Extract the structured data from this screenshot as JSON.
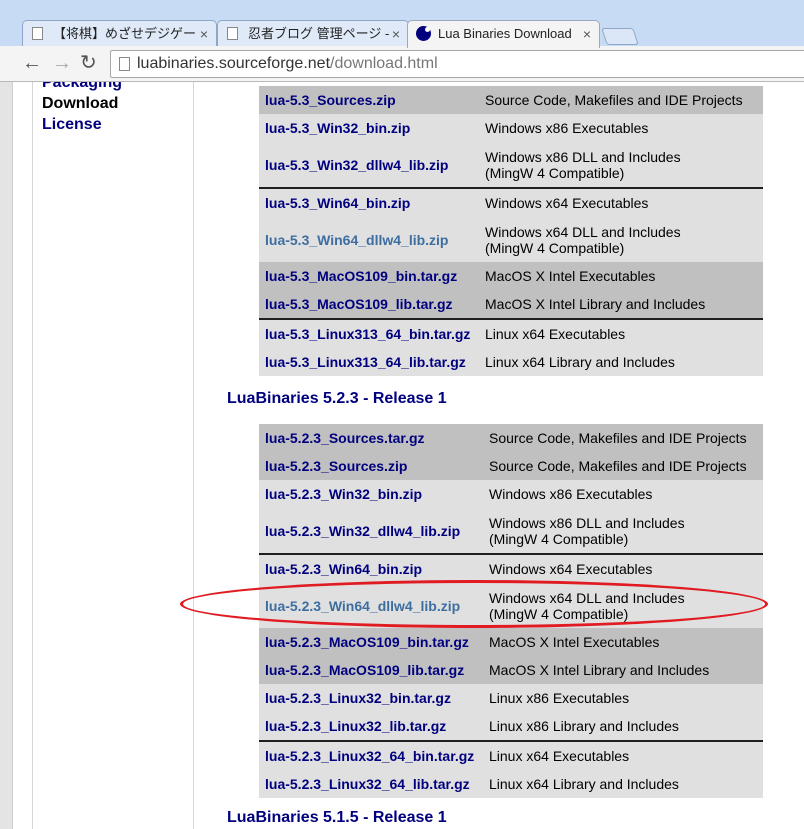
{
  "browser": {
    "tabs": [
      {
        "label": "【将棋】めざせデジゲー"
      },
      {
        "label": "忍者ブログ 管理ページ -"
      },
      {
        "label": "Lua Binaries Download"
      }
    ],
    "close_glyph": "×",
    "url_domain": "luabinaries.sourceforge.net",
    "url_path": "/download.html"
  },
  "sidebar": {
    "items": [
      {
        "label": "Packaging"
      },
      {
        "label": "Download"
      },
      {
        "label": "License"
      }
    ]
  },
  "section_53": {
    "files": [
      {
        "file": "lua-5.3_Sources.zip",
        "desc": "Source Code, Makefiles and IDE Projects"
      },
      {
        "file": "lua-5.3_Win32_bin.zip",
        "desc": "Windows x86 Executables"
      },
      {
        "file": "lua-5.3_Win32_dllw4_lib.zip",
        "desc": "Windows x86 DLL and Includes",
        "desc2": "(MingW 4 Compatible)"
      },
      {
        "file": "lua-5.3_Win64_bin.zip",
        "desc": "Windows x64 Executables"
      },
      {
        "file": "lua-5.3_Win64_dllw4_lib.zip",
        "desc": "Windows x64 DLL and Includes",
        "desc2": "(MingW 4 Compatible)"
      },
      {
        "file": "lua-5.3_MacOS109_bin.tar.gz",
        "desc": "MacOS X Intel Executables"
      },
      {
        "file": "lua-5.3_MacOS109_lib.tar.gz",
        "desc": "MacOS X Intel Library and Includes"
      },
      {
        "file": "lua-5.3_Linux313_64_bin.tar.gz",
        "desc": "Linux x64 Executables"
      },
      {
        "file": "lua-5.3_Linux313_64_lib.tar.gz",
        "desc": "Linux x64 Library and Includes"
      }
    ]
  },
  "section_523": {
    "title": "LuaBinaries 5.2.3 - Release 1",
    "files": [
      {
        "file": "lua-5.2.3_Sources.tar.gz",
        "desc": "Source Code, Makefiles and IDE Projects"
      },
      {
        "file": "lua-5.2.3_Sources.zip",
        "desc": "Source Code, Makefiles and IDE Projects"
      },
      {
        "file": "lua-5.2.3_Win32_bin.zip",
        "desc": "Windows x86 Executables"
      },
      {
        "file": "lua-5.2.3_Win32_dllw4_lib.zip",
        "desc": "Windows x86 DLL and Includes",
        "desc2": "(MingW 4 Compatible)"
      },
      {
        "file": "lua-5.2.3_Win64_bin.zip",
        "desc": "Windows x64 Executables"
      },
      {
        "file": "lua-5.2.3_Win64_dllw4_lib.zip",
        "desc": "Windows x64 DLL and Includes",
        "desc2": "(MingW 4 Compatible)"
      },
      {
        "file": "lua-5.2.3_MacOS109_bin.tar.gz",
        "desc": "MacOS X Intel Executables"
      },
      {
        "file": "lua-5.2.3_MacOS109_lib.tar.gz",
        "desc": "MacOS X Intel Library and Includes"
      },
      {
        "file": "lua-5.2.3_Linux32_bin.tar.gz",
        "desc": "Linux x86 Executables"
      },
      {
        "file": "lua-5.2.3_Linux32_lib.tar.gz",
        "desc": "Linux x86 Library and Includes"
      },
      {
        "file": "lua-5.2.3_Linux32_64_bin.tar.gz",
        "desc": "Linux x64 Executables"
      },
      {
        "file": "lua-5.2.3_Linux32_64_lib.tar.gz",
        "desc": "Linux x64 Library and Includes"
      }
    ]
  },
  "section_515": {
    "title": "LuaBinaries 5.1.5 - Release 1"
  },
  "colors": {
    "link": "#00007f",
    "visited_link": "#3e6ea0",
    "row_dark": "#c0c0c0",
    "row_light": "#e0e0e0",
    "annotation": "#e01c22"
  }
}
